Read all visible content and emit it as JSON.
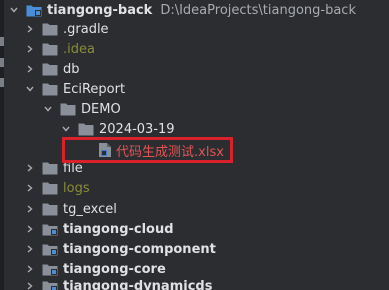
{
  "project": {
    "root_name": "tiangong-back",
    "root_path": "D:\\IdeaProjects\\tiangong-back"
  },
  "tree": {
    "gradle": ".gradle",
    "idea": ".idea",
    "db": "db",
    "ecireport": "EciReport",
    "demo": "DEMO",
    "date_folder": "2024-03-19",
    "selected_file": "代码生成测试.xlsx",
    "file": "file",
    "logs": "logs",
    "tg_excel": "tg_excel",
    "cloud": "tiangong-cloud",
    "component": "tiangong-component",
    "core": "tiangong-core",
    "dynamicds": "tiangong-dynamicds"
  },
  "colors": {
    "background": "#2b2d30",
    "folder": "#8a9099",
    "module_folder": "#4a8ed8",
    "excluded_text": "#8c8c3b",
    "selected_file_text": "#e05555",
    "highlight_border": "#d9212b"
  },
  "icons": {
    "collapsed": "chevron-right-icon",
    "expanded": "chevron-down-icon",
    "folder": "folder-icon",
    "module": "module-folder-icon",
    "excel": "excel-file-icon"
  }
}
